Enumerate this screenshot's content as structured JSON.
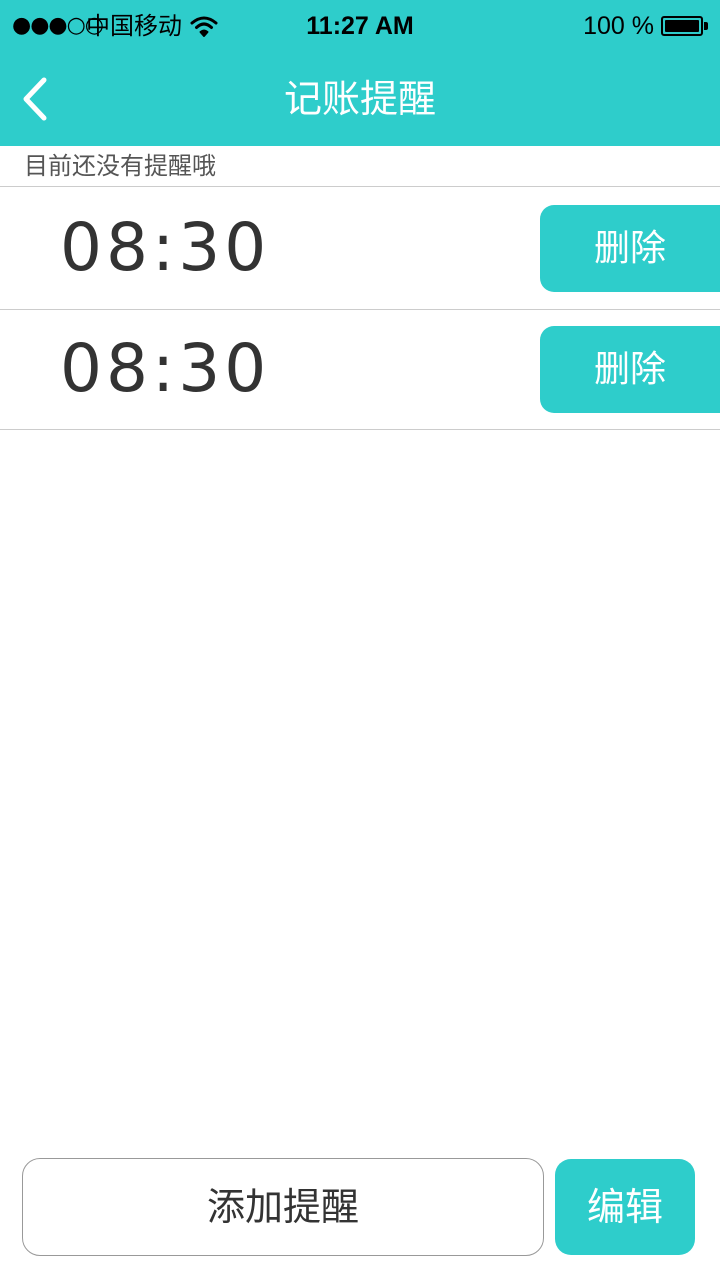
{
  "status_bar": {
    "signal": "●●●○○",
    "carrier": "中国移动",
    "wifi_icon": "wifi-icon",
    "time": "11:27 AM",
    "battery": "100 %",
    "battery_icon": "battery-icon"
  },
  "nav": {
    "back_icon": "chevron-left-icon",
    "title": "记账提醒"
  },
  "hint": "目前还没有提醒哦",
  "reminders": [
    {
      "time": "08:30",
      "delete_label": "删除"
    },
    {
      "time": "08:30",
      "delete_label": "删除"
    }
  ],
  "footer": {
    "add_label": "添加提醒",
    "edit_label": "编辑"
  },
  "colors": {
    "accent": "#2ecdcb",
    "text": "#333333",
    "divider": "#cccccc"
  }
}
